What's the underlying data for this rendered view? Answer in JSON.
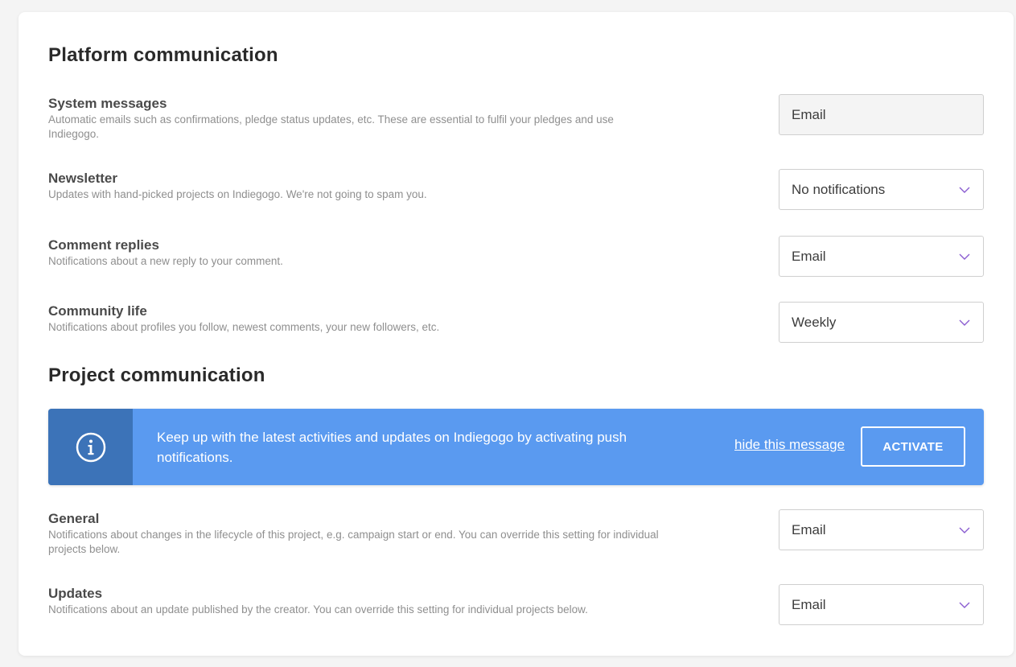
{
  "platform": {
    "title": "Platform communication",
    "rows": [
      {
        "title": "System messages",
        "description": "Automatic emails such as confirmations, pledge status updates, etc. These are essential to fulfil your pledges and use Indiegogo.",
        "value": "Email",
        "disabled": true
      },
      {
        "title": "Newsletter",
        "description": "Updates with hand-picked projects on Indiegogo. We're not going to spam you.",
        "value": "No notifications"
      },
      {
        "title": "Comment replies",
        "description": "Notifications about a new reply to your comment.",
        "value": "Email"
      },
      {
        "title": "Community life",
        "description": "Notifications about profiles you follow, newest comments, your new followers, etc.",
        "value": "Weekly"
      }
    ]
  },
  "project": {
    "title": "Project communication",
    "banner": {
      "icon": "info-icon",
      "text": "Keep up with the latest activities and updates on Indiegogo by activating push notifications.",
      "hide_label": "hide this message",
      "activate_label": "ACTIVATE"
    },
    "rows": [
      {
        "title": "General",
        "description": "Notifications about changes in the lifecycle of this project, e.g. campaign start or end. You can override this setting for individual projects below.",
        "value": "Email"
      },
      {
        "title": "Updates",
        "description": "Notifications about an update published by the creator. You can override this setting for individual projects below.",
        "value": "Email"
      }
    ]
  },
  "colors": {
    "banner_bg": "#5a9af0",
    "banner_icon_bg": "#3c73b8",
    "chevron": "#8a5cd0"
  },
  "icons": {
    "select_chevron": "chevron-down-icon"
  }
}
